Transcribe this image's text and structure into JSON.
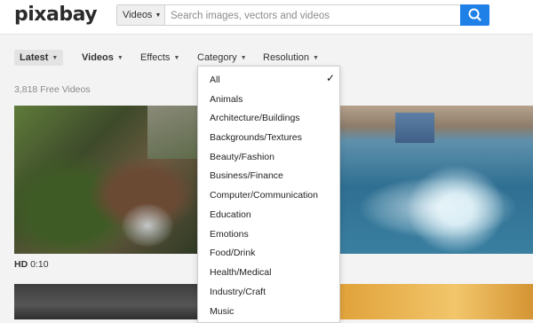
{
  "header": {
    "logo": "pixabay",
    "search": {
      "type_label": "Videos",
      "placeholder": "Search images, vectors and videos"
    },
    "search_icon": "search-icon"
  },
  "toolbar": {
    "latest": "Latest",
    "videos": "Videos",
    "effects": "Effects",
    "category": "Category",
    "resolution": "Resolution"
  },
  "results": {
    "count": "3,818 Free Videos",
    "first_item": {
      "quality": "HD",
      "duration": "0:10"
    }
  },
  "category_dropdown": {
    "selected": "All",
    "items": [
      "All",
      "Animals",
      "Architecture/Buildings",
      "Backgrounds/Textures",
      "Beauty/Fashion",
      "Business/Finance",
      "Computer/Communication",
      "Education",
      "Emotions",
      "Food/Drink",
      "Health/Medical",
      "Industry/Craft",
      "Music"
    ]
  },
  "colors": {
    "accent": "#1f80e8",
    "background": "#f3f3f3"
  }
}
